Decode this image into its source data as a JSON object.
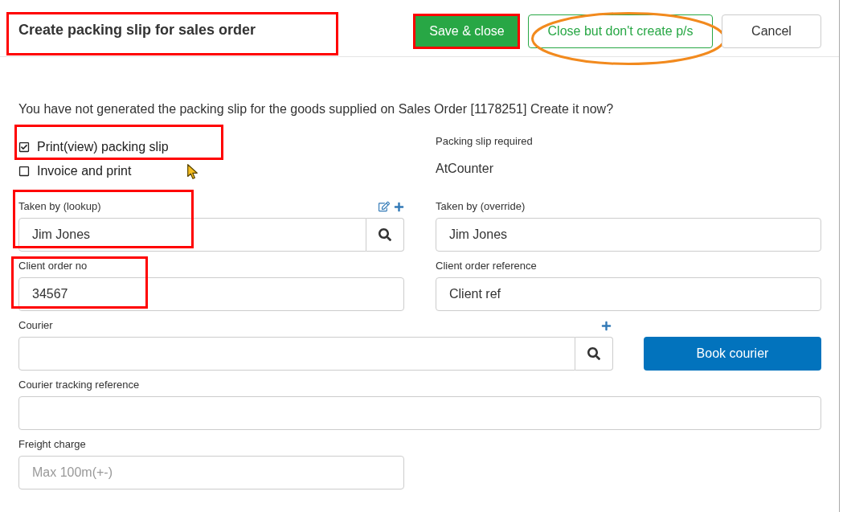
{
  "dialog": {
    "title": {
      "text": "Create packing slip for sales order",
      "boxed": true
    },
    "buttons": [
      {
        "label": "Save & close",
        "kind": "primary",
        "boxed": true,
        "circled": false
      },
      {
        "label": "Close but don't create p/s",
        "kind": "outline",
        "boxed": false,
        "circled": true
      },
      {
        "label": "Cancel",
        "kind": "default",
        "boxed": false,
        "circled": false
      }
    ]
  },
  "message": "You have not generated the packing slip for the goods supplied on Sales Order [1178251] Create it now?",
  "options": [
    {
      "label": "Print(view) packing slip",
      "checked": true,
      "boxed": true
    },
    {
      "label": "Invoice and print",
      "checked": false,
      "boxed": false
    }
  ],
  "packing_slip_required": {
    "label": "Packing slip required",
    "value": "AtCounter"
  },
  "taken_by_lookup": {
    "label": "Taken by (lookup)",
    "value": "Jim Jones",
    "boxed": true
  },
  "taken_by_override": {
    "label": "Taken by (override)",
    "value": "Jim Jones"
  },
  "client_order_no": {
    "label": "Client order no",
    "value": "34567",
    "boxed": true
  },
  "client_order_reference": {
    "label": "Client order reference",
    "value": "Client ref"
  },
  "courier": {
    "label": "Courier"
  },
  "book_courier_button": {
    "label": "Book courier"
  },
  "courier_tracking_reference": {
    "label": "Courier tracking reference"
  },
  "freight_charge": {
    "label": "Freight charge",
    "placeholder": "Max 100m(+-)"
  }
}
